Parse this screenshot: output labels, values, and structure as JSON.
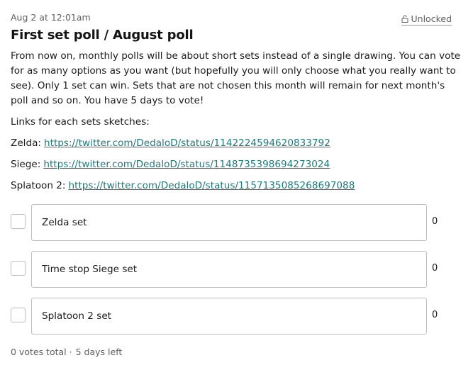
{
  "post": {
    "date": "Aug 2 at 12:01am",
    "lock_status": "Unlocked",
    "lock_icon": "unlocked-padlock-icon",
    "title": "First set poll / August poll",
    "intro": "From now on, monthly polls will be about short sets instead of a single drawing. You can vote for as many options as you want (but hopefully you will only choose what you really want to see). Only 1 set can win. Sets that are not chosen this month will remain for next month's poll and so on. You have 5 days to vote!",
    "links_heading": "Links for each sets sketches:",
    "links": [
      {
        "label": "Zelda:",
        "url": "https://twitter.com/DedaloD/status/1142224594620833792"
      },
      {
        "label": "Siege:",
        "url": "https://twitter.com/DedaloD/status/1148735398694273024"
      },
      {
        "label": "Splatoon 2:",
        "url": "https://twitter.com/DedaloD/status/1157135085268697088"
      }
    ]
  },
  "poll": {
    "options": [
      {
        "label": "Zelda set",
        "count": "0",
        "checked": false
      },
      {
        "label": "Time stop Siege set",
        "count": "0",
        "checked": false
      },
      {
        "label": "Splatoon 2 set",
        "count": "0",
        "checked": false
      }
    ],
    "votes_total": "0 votes total",
    "separator": "·",
    "time_left": "5 days left"
  },
  "colors": {
    "link": "#1d7a7e",
    "muted_text": "#5f5f5f",
    "border": "#bdbdbd"
  }
}
